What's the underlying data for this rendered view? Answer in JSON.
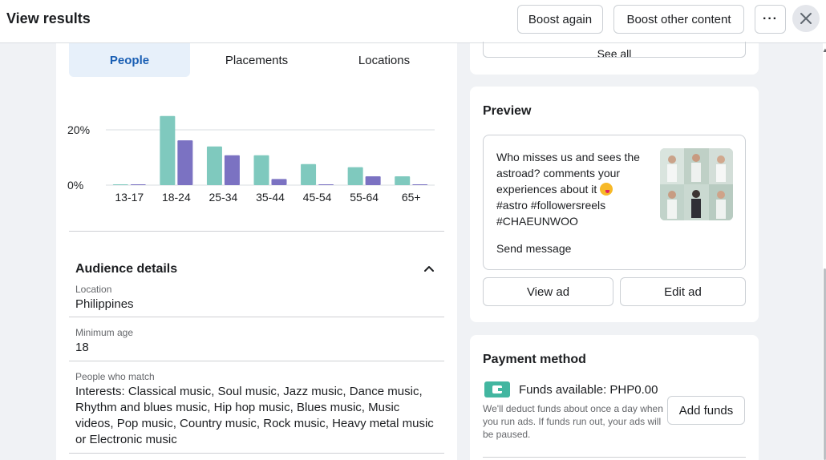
{
  "header": {
    "title": "View results",
    "boost_again_label": "Boost again",
    "boost_other_label": "Boost other content",
    "more_label": "···"
  },
  "tabs": [
    {
      "label": "People",
      "active": true
    },
    {
      "label": "Placements",
      "active": false
    },
    {
      "label": "Locations",
      "active": false
    }
  ],
  "chart_data": {
    "type": "bar",
    "categories": [
      "13-17",
      "18-24",
      "25-34",
      "35-44",
      "45-54",
      "55-64",
      "65+"
    ],
    "series": [
      {
        "values": [
          0.2,
          25,
          14,
          10.8,
          7.6,
          6.5,
          3.2
        ],
        "color": "#7fc9be"
      },
      {
        "values": [
          0.2,
          16.2,
          10.8,
          2.2,
          0.2,
          3.2,
          0.2
        ],
        "color": "#7b72c2"
      }
    ],
    "ytick_labels": [
      "20%",
      "0%"
    ],
    "yticks": [
      20,
      0
    ],
    "ylim": [
      0,
      26
    ],
    "grid": true
  },
  "audience": {
    "title": "Audience details",
    "location_label": "Location",
    "location_value": "Philippines",
    "min_age_label": "Minimum age",
    "min_age_value": "18",
    "match_label": "People who match",
    "match_value": "Interests: Classical music, Soul music, Jazz music, Dance music, Rhythm and blues music, Hip hop music, Blues music, Music videos, Pop music, Country music, Rock music, Heavy metal music or Electronic music"
  },
  "see_all_label": "See all",
  "preview": {
    "title": "Preview",
    "post_line1": "Who misses us and sees the astroad? comments your experiences about it",
    "post_line2": "#astro #followersreels #CHAEUNWOO",
    "send_message": "Send message",
    "view_ad_label": "View ad",
    "edit_ad_label": "Edit ad"
  },
  "payment": {
    "title": "Payment method",
    "funds_label": "Funds available: PHP0.00",
    "note": "We'll deduct funds about once a day when you run ads. If funds run out, your ads will be paused.",
    "add_funds_label": "Add funds"
  }
}
